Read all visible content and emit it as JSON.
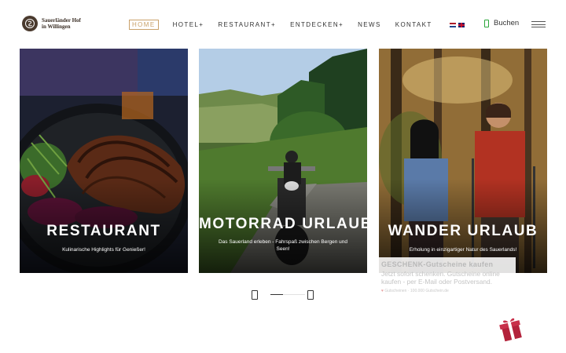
{
  "brand": {
    "line1": "Sauerländer Hof",
    "line2": "in Willingen"
  },
  "nav": {
    "items": [
      {
        "label": "HOME",
        "active": true
      },
      {
        "label": "HOTEL+",
        "active": false
      },
      {
        "label": "RESTAURANT+",
        "active": false
      },
      {
        "label": "ENTDECKEN+",
        "active": false
      },
      {
        "label": "NEWS",
        "active": false
      },
      {
        "label": "KONTAKT",
        "active": false
      }
    ],
    "languages": [
      "nl",
      "en"
    ]
  },
  "booking": {
    "label": "Buchen"
  },
  "cards": [
    {
      "title": "RESTAURANT",
      "subtitle": "Kulinarische Highlights für Genießer!"
    },
    {
      "title": "MOTORRAD URLAUB",
      "subtitle": "Das Sauerland erleben - Fahrspaß zwischen Bergen und Seen!"
    },
    {
      "title": "WANDER URLAUB",
      "subtitle": "Erholung in einzigartiger Natur des Sauerlands!"
    }
  ],
  "voucher": {
    "title": "GESCHENK-Gutscheine kaufen",
    "text": "Jetzt sofort schenken. Gutscheine online kaufen - per E-Mail oder Postversand.",
    "meta": "Gutscheinen · 100.000 Gutschein.de"
  },
  "colors": {
    "accent": "#c9a16a",
    "booking_icon": "#2aa53a",
    "gift": "#b3223b"
  }
}
